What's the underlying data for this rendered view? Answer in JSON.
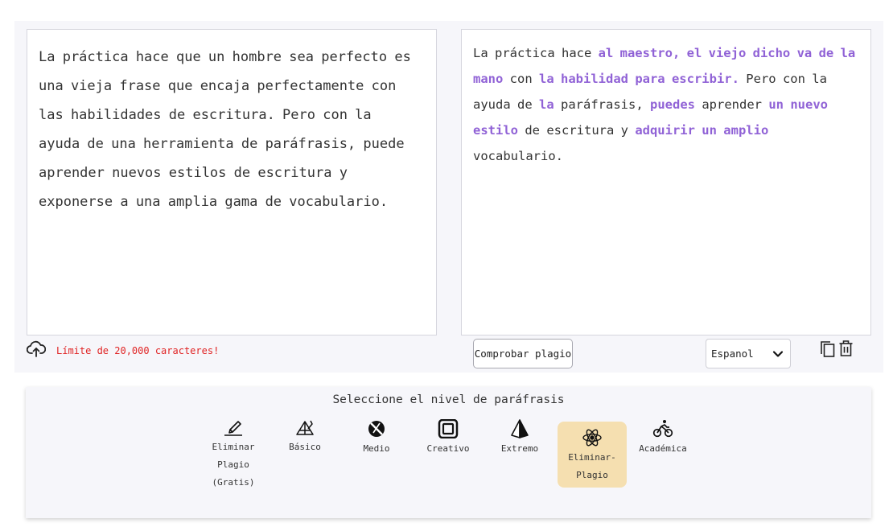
{
  "input": {
    "text": "La práctica hace que un hombre sea perfecto es una vieja frase que encaja perfectamente con las habilidades de escritura. Pero con la ayuda de una herramienta de paráfrasis, puede aprender nuevos estilos de escritura y exponerse a una amplia gama de vocabulario.",
    "char_limit": "Límite de 20,000 caracteres!"
  },
  "output": {
    "segments": [
      {
        "text": "La práctica hace ",
        "highlight": false
      },
      {
        "text": "al maestro, el viejo dicho va de la mano",
        "highlight": true
      },
      {
        "text": " con ",
        "highlight": false
      },
      {
        "text": "la habilidad para escribir.",
        "highlight": true
      },
      {
        "text": " Pero con la ayuda de ",
        "highlight": false
      },
      {
        "text": "la",
        "highlight": true
      },
      {
        "text": " paráfrasis, ",
        "highlight": false
      },
      {
        "text": "puedes",
        "highlight": true
      },
      {
        "text": " aprender ",
        "highlight": false
      },
      {
        "text": "un nuevo estilo",
        "highlight": true
      },
      {
        "text": " de escritura y ",
        "highlight": false
      },
      {
        "text": "adquirir un amplio",
        "highlight": true
      },
      {
        "text": " vocabulario.",
        "highlight": false
      }
    ],
    "highlight_color": "#9062d6"
  },
  "toolbar": {
    "check_plagiarism_label": "Comprobar plagio",
    "language_selected": "Espanol"
  },
  "levels": {
    "title": "Seleccione el nivel de paráfrasis",
    "items": [
      {
        "label": "Eliminar\nPlagio\n(Gratis)",
        "icon": "pen-eraser-icon",
        "active": false
      },
      {
        "label": "Básico",
        "icon": "pyramid-sketch-icon",
        "active": false
      },
      {
        "label": "Medio",
        "icon": "no-pen-icon",
        "active": false
      },
      {
        "label": "Creativo",
        "icon": "squares-icon",
        "active": false
      },
      {
        "label": "Extremo",
        "icon": "prism-icon",
        "active": false
      },
      {
        "label": "Eliminar-\nPlagio",
        "icon": "atom-icon",
        "active": true
      },
      {
        "label": "Académica",
        "icon": "cyclist-icon",
        "active": false
      }
    ],
    "active_color": "#f5dfb0"
  },
  "colors": {
    "char_limit": "#e02424",
    "panel_bg": "#f6f6fa"
  }
}
